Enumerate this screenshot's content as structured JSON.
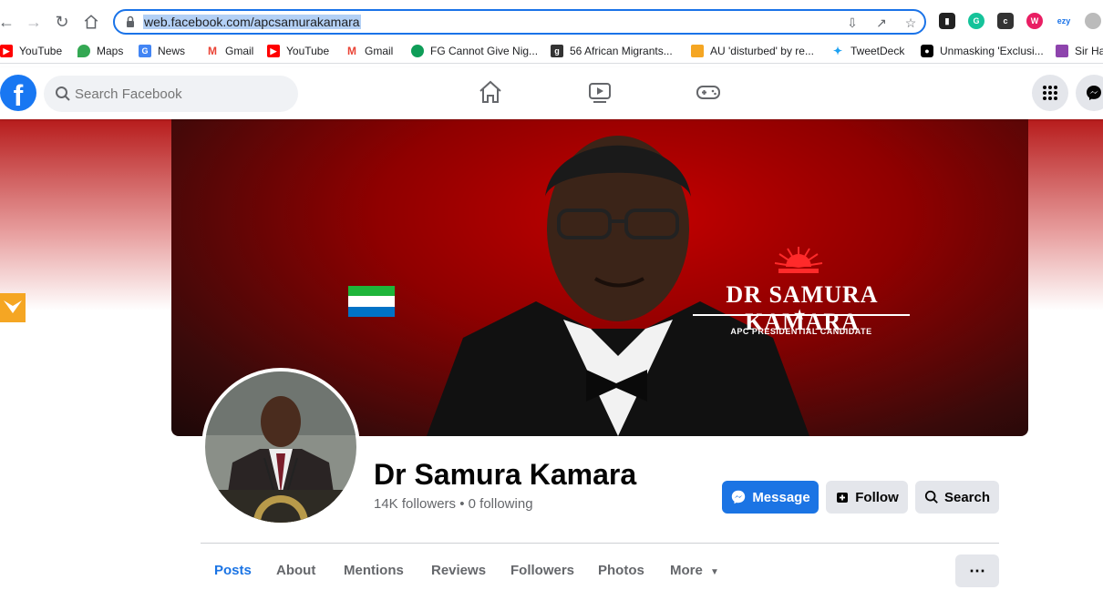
{
  "browser": {
    "url_display": "web.facebook.com/apcsamurakamara"
  },
  "bookmarks": [
    {
      "label": "YouTube",
      "icon": "youtube-icon",
      "color": "#ff0000"
    },
    {
      "label": "Maps",
      "icon": "maps-icon",
      "color": "#34a853"
    },
    {
      "label": "News",
      "icon": "news-icon",
      "color": "#4285f4"
    },
    {
      "label": "Gmail",
      "icon": "gmail-icon",
      "color": "#ea4335"
    },
    {
      "label": "YouTube",
      "icon": "youtube-icon",
      "color": "#ff0000"
    },
    {
      "label": "Gmail",
      "icon": "gmail-icon",
      "color": "#ea4335"
    },
    {
      "label": "FG Cannot Give Nig...",
      "icon": "site-icon",
      "color": "#0f9d58"
    },
    {
      "label": "56 African Migrants...",
      "icon": "site-icon",
      "color": "#333333"
    },
    {
      "label": "AU 'disturbed' by re...",
      "icon": "site-icon",
      "color": "#f5a623"
    },
    {
      "label": "TweetDeck",
      "icon": "twitter-icon",
      "color": "#1da1f2"
    },
    {
      "label": "Unmasking 'Exclusi...",
      "icon": "medium-icon",
      "color": "#000000"
    },
    {
      "label": "Sir Ha",
      "icon": "site-icon",
      "color": "#8e44ad"
    }
  ],
  "facebook": {
    "search_placeholder": "Search Facebook",
    "logo_letter": "f"
  },
  "cover": {
    "name": "DR SAMURA KAMARA",
    "subtitle": "APC PRESIDENTIAL CANDIDATE"
  },
  "profile": {
    "name": "Dr Samura Kamara",
    "followers": "14K followers",
    "following": "0 following",
    "separator": "•"
  },
  "actions": {
    "message": "Message",
    "follow": "Follow",
    "search": "Search"
  },
  "tabs": [
    "Posts",
    "About",
    "Mentions",
    "Reviews",
    "Followers",
    "Photos",
    "More"
  ],
  "colors": {
    "facebook_blue": "#1b74e4",
    "flag_green": "#1eb53a",
    "flag_white": "#ffffff",
    "flag_blue": "#0072c6"
  }
}
